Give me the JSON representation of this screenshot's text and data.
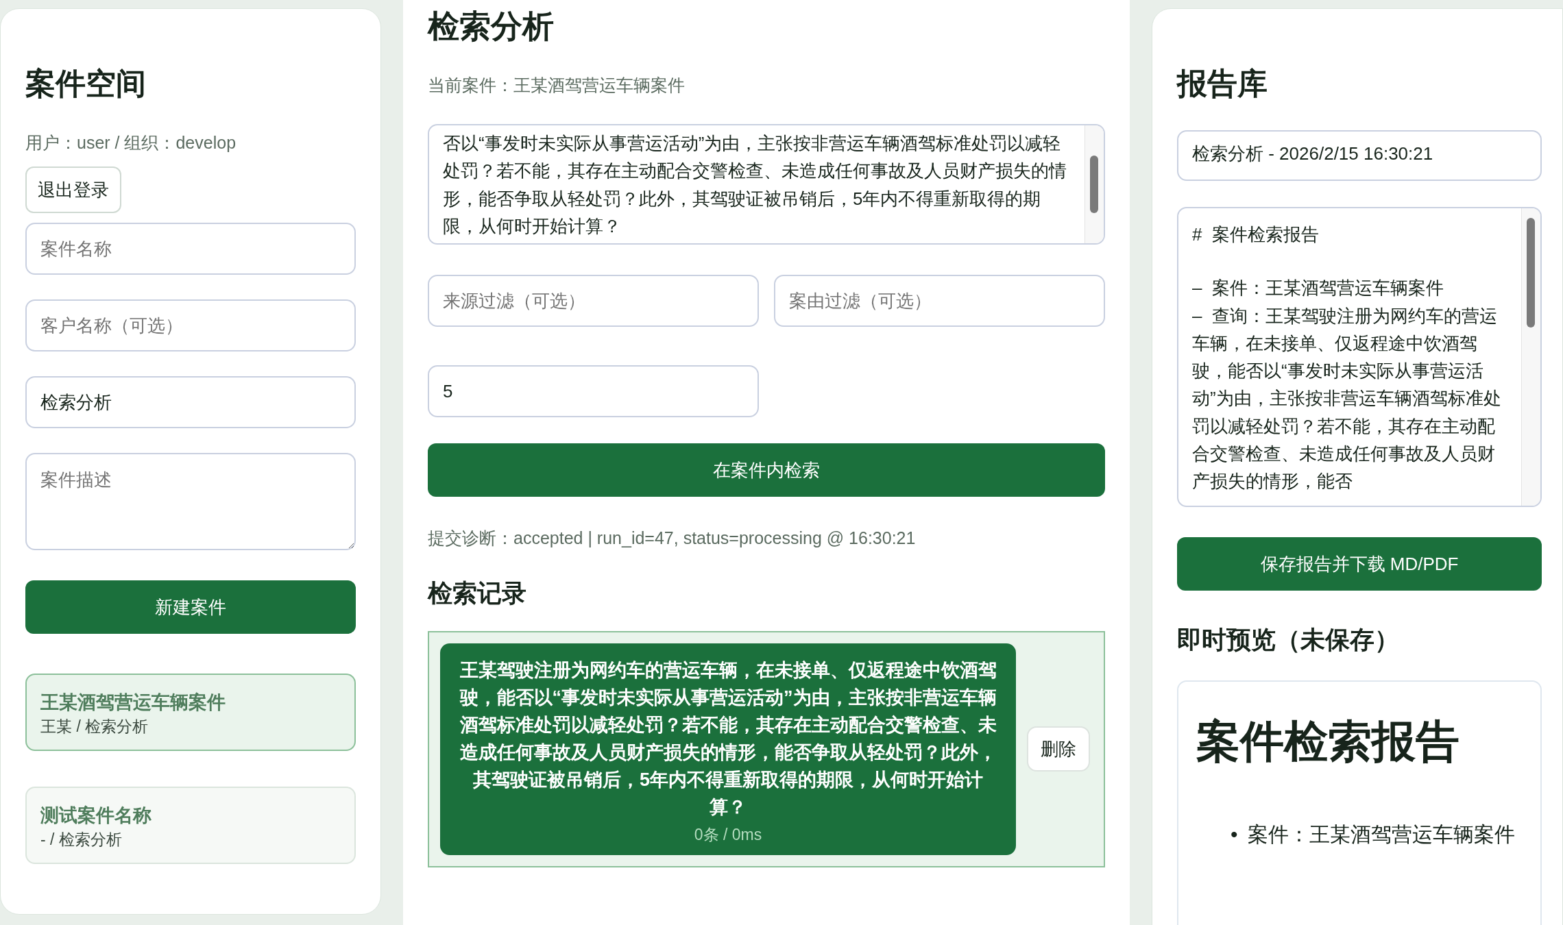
{
  "workspace": {
    "title": "案件空间",
    "user_info": "用户：user / 组织：develop",
    "logout": "退出登录",
    "fields": [
      {
        "kind": "input",
        "placeholder": "案件名称"
      },
      {
        "kind": "input",
        "placeholder": "客户名称（可选）"
      },
      {
        "kind": "input",
        "value": "检索分析"
      },
      {
        "kind": "textarea",
        "placeholder": "案件描述"
      }
    ],
    "create_button": "新建案件",
    "cases": [
      {
        "title": "王某酒驾营运车辆案件",
        "subtitle": "王某 / 检索分析",
        "selected": true
      },
      {
        "title": "测试案件名称",
        "subtitle": "- / 检索分析",
        "selected": false
      }
    ]
  },
  "search": {
    "title": "检索分析",
    "current_case": "当前案件：王某酒驾营运车辆案件",
    "query": "否以“事发时未实际从事营运活动”为由，主张按非营运车辆酒驾标准处罚以减轻处罚？若不能，其存在主动配合交警检查、未造成任何事故及人员财产损失的情形，能否争取从轻处罚？此外，其驾驶证被吊销后，5年内不得重新取得的期限，从何时开始计算？",
    "filters": [
      {
        "placeholder": "来源过滤（可选）"
      },
      {
        "placeholder": "案由过滤（可选）"
      }
    ],
    "top_k": "5",
    "search_button": "在案件内检索",
    "diagnostic": "提交诊断：accepted | run_id=47, status=processing @ 16:30:21",
    "history_title": "检索记录",
    "history": [
      {
        "query": "王某驾驶注册为网约车的营运车辆，在未接单、仅返程途中饮酒驾驶，能否以“事发时未实际从事营运活动”为由，主张按非营运车辆酒驾标准处罚以减轻处罚？若不能，其存在主动配合交警检查、未造成任何事故及人员财产损失的情形，能否争取从轻处罚？此外，其驾驶证被吊销后，5年内不得重新取得的期限，从何时开始计算？",
        "meta": "0条 / 0ms",
        "delete": "删除"
      }
    ]
  },
  "reports": {
    "title": "报告库",
    "report_title": "检索分析 - 2026/2/15 16:30:21",
    "markdown_heading": "#  案件检索报告",
    "markdown_lines": [
      "–  案件：王某酒驾营运车辆案件",
      "–  查询：王某驾驶注册为网约车的营运车辆，在未接单、仅返程途中饮酒驾驶，能否以“事发时未实际从事营运活动”为由，主张按非营运车辆酒驾标准处罚以减轻处罚？若不能，其存在主动配合交警检查、未造成任何事故及人员财产损失的情形，能否"
    ],
    "save_button": "保存报告并下载 MD/PDF",
    "preview_title": "即时预览（未保存）",
    "preview": {
      "heading": "案件检索报告",
      "items": [
        {
          "bullet": "•",
          "text": "案件：王某酒驾营运车辆案件"
        }
      ]
    }
  }
}
